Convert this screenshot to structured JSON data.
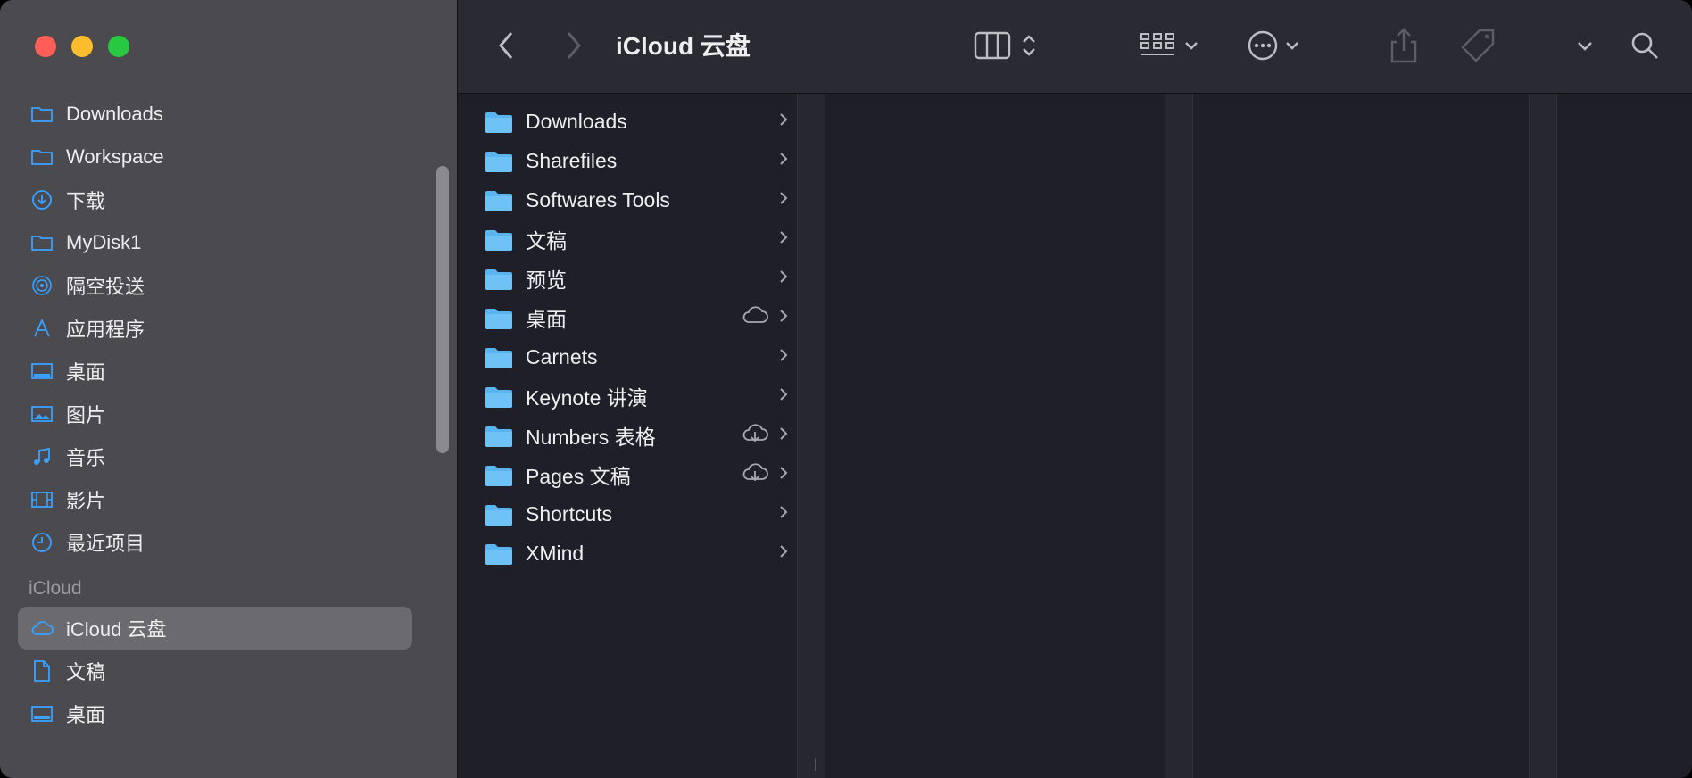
{
  "window": {
    "title": "iCloud 云盘"
  },
  "sidebar": {
    "items": [
      {
        "label": "Downloads",
        "icon": "folder-icon"
      },
      {
        "label": "Workspace",
        "icon": "folder-icon"
      },
      {
        "label": "下载",
        "icon": "download-icon"
      },
      {
        "label": "MyDisk1",
        "icon": "folder-icon"
      },
      {
        "label": "隔空投送",
        "icon": "airdrop-icon"
      },
      {
        "label": "应用程序",
        "icon": "applications-icon"
      },
      {
        "label": "桌面",
        "icon": "desktop-icon"
      },
      {
        "label": "图片",
        "icon": "photos-icon"
      },
      {
        "label": "音乐",
        "icon": "music-icon"
      },
      {
        "label": "影片",
        "icon": "movies-icon"
      },
      {
        "label": "最近项目",
        "icon": "clock-icon"
      }
    ],
    "section_icloud": "iCloud",
    "icloud_items": [
      {
        "label": "iCloud 云盘",
        "icon": "cloud-icon",
        "selected": true
      },
      {
        "label": "文稿",
        "icon": "document-icon"
      },
      {
        "label": "桌面",
        "icon": "desktop-icon"
      }
    ]
  },
  "files": [
    {
      "name": "Downloads",
      "icon": "folder-icon",
      "cloud": false
    },
    {
      "name": "Sharefiles",
      "icon": "folder-icon",
      "cloud": false
    },
    {
      "name": "Softwares Tools",
      "icon": "folder-icon",
      "cloud": false
    },
    {
      "name": "文稿",
      "icon": "documents-folder-icon",
      "cloud": false
    },
    {
      "name": "预览",
      "icon": "preview-folder-icon",
      "cloud": false
    },
    {
      "name": "桌面",
      "icon": "desktop-folder-icon",
      "cloud": "cloud-icon"
    },
    {
      "name": "Carnets",
      "icon": "carnets-folder-icon",
      "cloud": false
    },
    {
      "name": "Keynote 讲演",
      "icon": "keynote-folder-icon",
      "cloud": false
    },
    {
      "name": "Numbers 表格",
      "icon": "numbers-folder-icon",
      "cloud": "cloud-download-icon"
    },
    {
      "name": "Pages 文稿",
      "icon": "pages-folder-icon",
      "cloud": "cloud-download-icon"
    },
    {
      "name": "Shortcuts",
      "icon": "shortcuts-folder-icon",
      "cloud": false
    },
    {
      "name": "XMind",
      "icon": "xmind-folder-icon",
      "cloud": false
    }
  ],
  "colors": {
    "accent": "#3aa1ff",
    "folder": "#5ab4f0"
  }
}
